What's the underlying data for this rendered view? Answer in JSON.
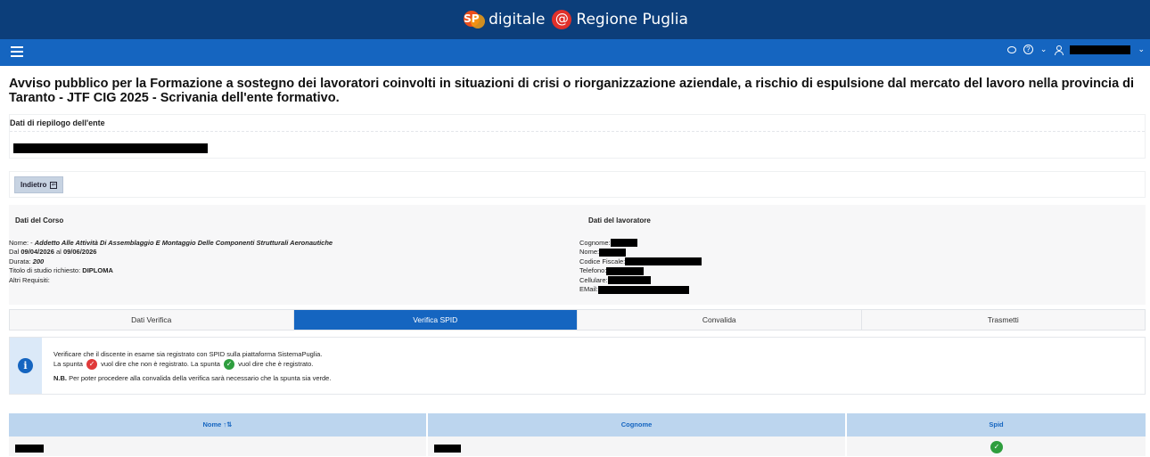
{
  "header": {
    "brand_sp": "SP",
    "brand_prefix": "digitale",
    "brand_at": "@",
    "brand_suffix": "Regione Puglia"
  },
  "navbar": {
    "icons": [
      "menu-icon",
      "chat-icon",
      "help-icon",
      "user-icon",
      "chevron-down-icon"
    ]
  },
  "page": {
    "title": "Avviso pubblico per la Formazione a sostegno dei lavoratori coinvolti in situazioni di crisi o riorganizzazione aziendale, a rischio di espulsione dal mercato del lavoro nella provincia di Taranto - JTF CIG 2025 - Scrivania dell'ente formativo."
  },
  "riepilogo": {
    "label": "Dati di riepilogo dell'ente"
  },
  "actions": {
    "back_label": "Indietro",
    "back_icon": "exit-icon"
  },
  "corso": {
    "heading": "Dati del Corso",
    "nome_label": "Nome: -",
    "nome_value": "Addetto Alle Attività Di Assemblaggio E Montaggio Delle Componenti Strutturali Aeronautiche",
    "dal_label": "Dal",
    "dal_value": "09/04/2026",
    "al_label": "al",
    "al_value": "09/06/2026",
    "durata_label": "Durata:",
    "durata_value": "200",
    "titolo_label": "Titolo di studio richiesto:",
    "titolo_value": "DIPLOMA",
    "altri_label": "Altri Requisiti:"
  },
  "lavoratore": {
    "heading": "Dati del lavoratore",
    "cognome_label": "Cognome:",
    "nome_label": "Nome:",
    "cf_label": "Codice Fiscale:",
    "telefono_label": "Telefono:",
    "cellulare_label": "Cellulare:",
    "email_label": "EMail:"
  },
  "tabs": [
    {
      "label": "Dati Verifica",
      "active": false
    },
    {
      "label": "Verifica SPID",
      "active": true
    },
    {
      "label": "Convalida",
      "active": false
    },
    {
      "label": "Trasmetti",
      "active": false
    }
  ],
  "info": {
    "icon": "info-icon",
    "line1": "Verificare che il discente in esame sia registrato con SPID sulla piattaforma SistemaPuglia.",
    "line2_a": "La spunta",
    "line2_b": "vuol dire che non è registrato. La spunta",
    "line2_c": "vuol dire che è registrato.",
    "nb_label": "N.B.",
    "nb_text": "Per poter procedere alla convalida della verifica sarà necessario che la spunta sia verde."
  },
  "table": {
    "columns": [
      "Nome ↑⇅",
      "Cognome",
      "Spid"
    ],
    "rows": [
      {
        "nome": "",
        "cognome": "",
        "spid": "registered"
      }
    ]
  },
  "colors": {
    "header_bg": "#0c3e7a",
    "nav_bg": "#1565c0",
    "active_tab": "#1565c0",
    "not_registered": "#e03a3a",
    "registered": "#2e9e3e",
    "table_header_bg": "#bcd5ee"
  }
}
